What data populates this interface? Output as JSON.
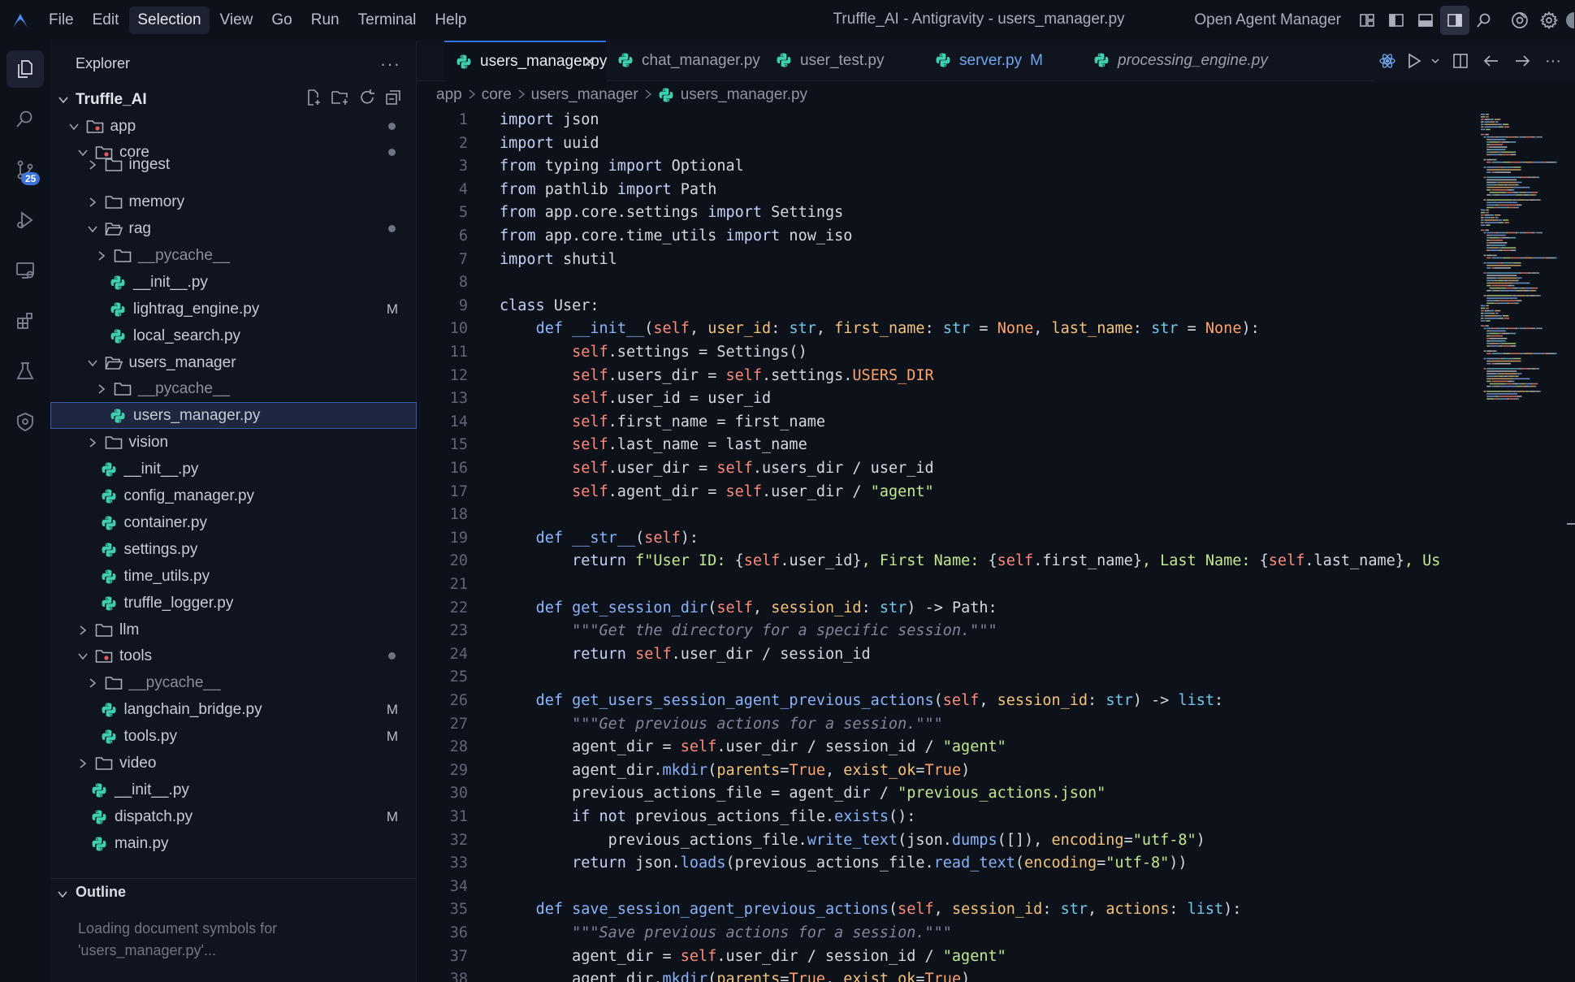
{
  "titlebar": {
    "menus": [
      "File",
      "Edit",
      "Selection",
      "View",
      "Go",
      "Run",
      "Terminal",
      "Help"
    ],
    "active_menu": "Selection",
    "window_title": "Truffle_AI - Antigravity - users_manager.py",
    "agent_manager_label": "Open Agent Manager"
  },
  "activity": {
    "scm_badge": "25"
  },
  "sidebar": {
    "title": "Explorer",
    "root": "Truffle_AI",
    "tree": [
      {
        "label": "app",
        "depth": 1,
        "kind": "folder-special",
        "chev": "down",
        "dot": true
      },
      {
        "label": "core",
        "depth": 2,
        "kind": "folder-special",
        "chev": "down",
        "dot": true
      },
      {
        "label": "ingest",
        "depth": 3,
        "kind": "folder",
        "chev": "right",
        "partial": true
      },
      {
        "label": "memory",
        "depth": 3,
        "kind": "folder",
        "chev": "right"
      },
      {
        "label": "rag",
        "depth": 3,
        "kind": "folder",
        "chev": "down",
        "dot": true
      },
      {
        "label": "__pycache__",
        "depth": 4,
        "kind": "folder",
        "chev": "right",
        "dim": true
      },
      {
        "label": "__init__.py",
        "depth": 4,
        "kind": "py"
      },
      {
        "label": "lightrag_engine.py",
        "depth": 4,
        "kind": "py",
        "badge": "M"
      },
      {
        "label": "local_search.py",
        "depth": 4,
        "kind": "py"
      },
      {
        "label": "users_manager",
        "depth": 3,
        "kind": "folder",
        "chev": "down"
      },
      {
        "label": "__pycache__",
        "depth": 4,
        "kind": "folder",
        "chev": "right",
        "dim": true
      },
      {
        "label": "users_manager.py",
        "depth": 4,
        "kind": "py",
        "selected": true
      },
      {
        "label": "vision",
        "depth": 3,
        "kind": "folder",
        "chev": "right"
      },
      {
        "label": "__init__.py",
        "depth": 3,
        "kind": "py"
      },
      {
        "label": "config_manager.py",
        "depth": 3,
        "kind": "py"
      },
      {
        "label": "container.py",
        "depth": 3,
        "kind": "py"
      },
      {
        "label": "settings.py",
        "depth": 3,
        "kind": "py"
      },
      {
        "label": "time_utils.py",
        "depth": 3,
        "kind": "py"
      },
      {
        "label": "truffle_logger.py",
        "depth": 3,
        "kind": "py"
      },
      {
        "label": "llm",
        "depth": 2,
        "kind": "folder",
        "chev": "right"
      },
      {
        "label": "tools",
        "depth": 2,
        "kind": "folder-special",
        "chev": "down",
        "dot": true
      },
      {
        "label": "__pycache__",
        "depth": 3,
        "kind": "folder",
        "chev": "right",
        "dim": true
      },
      {
        "label": "langchain_bridge.py",
        "depth": 3,
        "kind": "py",
        "badge": "M"
      },
      {
        "label": "tools.py",
        "depth": 3,
        "kind": "py",
        "badge": "M"
      },
      {
        "label": "video",
        "depth": 2,
        "kind": "folder",
        "chev": "right"
      },
      {
        "label": "__init__.py",
        "depth": 2,
        "kind": "py"
      },
      {
        "label": "dispatch.py",
        "depth": 2,
        "kind": "py",
        "badge": "M"
      },
      {
        "label": "main.py",
        "depth": 2,
        "kind": "py",
        "partial": true
      }
    ],
    "outline_title": "Outline",
    "outline_message": "Loading document symbols for 'users_manager.py'..."
  },
  "tabs": [
    {
      "label": "users_manager.py",
      "active": true
    },
    {
      "label": "chat_manager.py"
    },
    {
      "label": "user_test.py"
    },
    {
      "label": "server.py",
      "modified": true,
      "badge": "M"
    },
    {
      "label": "processing_engine.py",
      "italic": true
    }
  ],
  "breadcrumb": [
    "app",
    "core",
    "users_manager",
    "users_manager.py"
  ],
  "code": [
    [
      [
        "kw",
        "import"
      ],
      [
        "t",
        " json"
      ]
    ],
    [
      [
        "kw",
        "import"
      ],
      [
        "t",
        " uuid"
      ]
    ],
    [
      [
        "kw",
        "from"
      ],
      [
        "t",
        " typing "
      ],
      [
        "kw",
        "import"
      ],
      [
        "t",
        " Optional"
      ]
    ],
    [
      [
        "kw",
        "from"
      ],
      [
        "t",
        " pathlib "
      ],
      [
        "kw",
        "import"
      ],
      [
        "t",
        " Path"
      ]
    ],
    [
      [
        "kw",
        "from"
      ],
      [
        "t",
        " app.core.settings "
      ],
      [
        "kw",
        "import"
      ],
      [
        "t",
        " Settings"
      ]
    ],
    [
      [
        "kw",
        "from"
      ],
      [
        "t",
        " app.core.time_utils "
      ],
      [
        "kw",
        "import"
      ],
      [
        "t",
        " now_iso"
      ]
    ],
    [
      [
        "kw",
        "import"
      ],
      [
        "t",
        " shutil"
      ]
    ],
    [],
    [
      [
        "kw",
        "class"
      ],
      [
        "t",
        " User:"
      ]
    ],
    [
      [
        "t",
        "    "
      ],
      [
        "kw2",
        "def"
      ],
      [
        "t",
        " "
      ],
      [
        "fn",
        "__init__"
      ],
      [
        "t",
        "("
      ],
      [
        "self",
        "self"
      ],
      [
        "t",
        ", "
      ],
      [
        "pm",
        "user_id"
      ],
      [
        "t",
        ": "
      ],
      [
        "ty",
        "str"
      ],
      [
        "t",
        ", "
      ],
      [
        "pm",
        "first_name"
      ],
      [
        "t",
        ": "
      ],
      [
        "ty",
        "str"
      ],
      [
        "t",
        " = "
      ],
      [
        "at",
        "None"
      ],
      [
        "t",
        ", "
      ],
      [
        "pm",
        "last_name"
      ],
      [
        "t",
        ": "
      ],
      [
        "ty",
        "str"
      ],
      [
        "t",
        " = "
      ],
      [
        "at",
        "None"
      ],
      [
        "t",
        "):"
      ]
    ],
    [
      [
        "t",
        "        "
      ],
      [
        "self",
        "self"
      ],
      [
        "t",
        ".settings = Settings()"
      ]
    ],
    [
      [
        "t",
        "        "
      ],
      [
        "self",
        "self"
      ],
      [
        "t",
        ".users_dir = "
      ],
      [
        "self",
        "self"
      ],
      [
        "t",
        ".settings."
      ],
      [
        "at",
        "USERS_DIR"
      ]
    ],
    [
      [
        "t",
        "        "
      ],
      [
        "self",
        "self"
      ],
      [
        "t",
        ".user_id = user_id"
      ]
    ],
    [
      [
        "t",
        "        "
      ],
      [
        "self",
        "self"
      ],
      [
        "t",
        ".first_name = first_name"
      ]
    ],
    [
      [
        "t",
        "        "
      ],
      [
        "self",
        "self"
      ],
      [
        "t",
        ".last_name = last_name"
      ]
    ],
    [
      [
        "t",
        "        "
      ],
      [
        "self",
        "self"
      ],
      [
        "t",
        ".user_dir = "
      ],
      [
        "self",
        "self"
      ],
      [
        "t",
        ".users_dir / user_id"
      ]
    ],
    [
      [
        "t",
        "        "
      ],
      [
        "self",
        "self"
      ],
      [
        "t",
        ".agent_dir = "
      ],
      [
        "self",
        "self"
      ],
      [
        "t",
        ".user_dir / "
      ],
      [
        "str",
        "\"agent\""
      ]
    ],
    [],
    [
      [
        "t",
        "    "
      ],
      [
        "kw2",
        "def"
      ],
      [
        "t",
        " "
      ],
      [
        "fn",
        "__str__"
      ],
      [
        "t",
        "("
      ],
      [
        "self",
        "self"
      ],
      [
        "t",
        "):"
      ]
    ],
    [
      [
        "t",
        "        "
      ],
      [
        "kw",
        "return"
      ],
      [
        "t",
        " "
      ],
      [
        "str",
        "f\"User ID: "
      ],
      [
        "t",
        "{"
      ],
      [
        "self",
        "self"
      ],
      [
        "t",
        ".user_id}"
      ],
      [
        "str",
        ", First Name: "
      ],
      [
        "t",
        "{"
      ],
      [
        "self",
        "self"
      ],
      [
        "t",
        ".first_name}"
      ],
      [
        "str",
        ", Last Name: "
      ],
      [
        "t",
        "{"
      ],
      [
        "self",
        "self"
      ],
      [
        "t",
        ".last_name}"
      ],
      [
        "str",
        ", Us"
      ]
    ],
    [],
    [
      [
        "t",
        "    "
      ],
      [
        "kw2",
        "def"
      ],
      [
        "t",
        " "
      ],
      [
        "fn",
        "get_session_dir"
      ],
      [
        "t",
        "("
      ],
      [
        "self",
        "self"
      ],
      [
        "t",
        ", "
      ],
      [
        "pm",
        "session_id"
      ],
      [
        "t",
        ": "
      ],
      [
        "ty",
        "str"
      ],
      [
        "t",
        ") -> Path:"
      ]
    ],
    [
      [
        "t",
        "        "
      ],
      [
        "cm",
        "\"\"\"Get the directory for a specific session.\"\"\""
      ]
    ],
    [
      [
        "t",
        "        "
      ],
      [
        "kw",
        "return"
      ],
      [
        "t",
        " "
      ],
      [
        "self",
        "self"
      ],
      [
        "t",
        ".user_dir / session_id"
      ]
    ],
    [],
    [
      [
        "t",
        "    "
      ],
      [
        "kw2",
        "def"
      ],
      [
        "t",
        " "
      ],
      [
        "fn",
        "get_users_session_agent_previous_actions"
      ],
      [
        "t",
        "("
      ],
      [
        "self",
        "self"
      ],
      [
        "t",
        ", "
      ],
      [
        "pm",
        "session_id"
      ],
      [
        "t",
        ": "
      ],
      [
        "ty",
        "str"
      ],
      [
        "t",
        ") -> "
      ],
      [
        "ty",
        "list"
      ],
      [
        "t",
        ":"
      ]
    ],
    [
      [
        "t",
        "        "
      ],
      [
        "cm",
        "\"\"\"Get previous actions for a session.\"\"\""
      ]
    ],
    [
      [
        "t",
        "        agent_dir = "
      ],
      [
        "self",
        "self"
      ],
      [
        "t",
        ".user_dir / session_id / "
      ],
      [
        "str",
        "\"agent\""
      ]
    ],
    [
      [
        "t",
        "        agent_dir."
      ],
      [
        "fn",
        "mkdir"
      ],
      [
        "t",
        "("
      ],
      [
        "pm",
        "parents"
      ],
      [
        "t",
        "="
      ],
      [
        "at",
        "True"
      ],
      [
        "t",
        ", "
      ],
      [
        "pm",
        "exist_ok"
      ],
      [
        "t",
        "="
      ],
      [
        "at",
        "True"
      ],
      [
        "t",
        ")"
      ]
    ],
    [
      [
        "t",
        "        previous_actions_file = agent_dir / "
      ],
      [
        "str",
        "\"previous_actions.json\""
      ]
    ],
    [
      [
        "t",
        "        "
      ],
      [
        "kw",
        "if not"
      ],
      [
        "t",
        " previous_actions_file."
      ],
      [
        "fn",
        "exists"
      ],
      [
        "t",
        "():"
      ]
    ],
    [
      [
        "t",
        "            previous_actions_file."
      ],
      [
        "fn",
        "write_text"
      ],
      [
        "t",
        "(json."
      ],
      [
        "fn",
        "dumps"
      ],
      [
        "t",
        "([]), "
      ],
      [
        "pm",
        "encoding"
      ],
      [
        "t",
        "="
      ],
      [
        "str",
        "\"utf-8\""
      ],
      [
        "t",
        ")"
      ]
    ],
    [
      [
        "t",
        "        "
      ],
      [
        "kw",
        "return"
      ],
      [
        "t",
        " json."
      ],
      [
        "fn",
        "loads"
      ],
      [
        "t",
        "(previous_actions_file."
      ],
      [
        "fn",
        "read_text"
      ],
      [
        "t",
        "("
      ],
      [
        "pm",
        "encoding"
      ],
      [
        "t",
        "="
      ],
      [
        "str",
        "\"utf-8\""
      ],
      [
        "t",
        "))"
      ]
    ],
    [],
    [
      [
        "t",
        "    "
      ],
      [
        "kw2",
        "def"
      ],
      [
        "t",
        " "
      ],
      [
        "fn",
        "save_session_agent_previous_actions"
      ],
      [
        "t",
        "("
      ],
      [
        "self",
        "self"
      ],
      [
        "t",
        ", "
      ],
      [
        "pm",
        "session_id"
      ],
      [
        "t",
        ": "
      ],
      [
        "ty",
        "str"
      ],
      [
        "t",
        ", "
      ],
      [
        "pm",
        "actions"
      ],
      [
        "t",
        ": "
      ],
      [
        "ty",
        "list"
      ],
      [
        "t",
        "):"
      ]
    ],
    [
      [
        "t",
        "        "
      ],
      [
        "cm",
        "\"\"\"Save previous actions for a session.\"\"\""
      ]
    ],
    [
      [
        "t",
        "        agent_dir = "
      ],
      [
        "self",
        "self"
      ],
      [
        "t",
        ".user_dir / session_id / "
      ],
      [
        "str",
        "\"agent\""
      ]
    ],
    [
      [
        "t",
        "        agent_dir."
      ],
      [
        "fn",
        "mkdir"
      ],
      [
        "t",
        "("
      ],
      [
        "pm",
        "parents"
      ],
      [
        "t",
        "="
      ],
      [
        "at",
        "True"
      ],
      [
        "t",
        ", "
      ],
      [
        "pm",
        "exist_ok"
      ],
      [
        "t",
        "="
      ],
      [
        "at",
        "True"
      ],
      [
        "t",
        ")"
      ]
    ]
  ]
}
